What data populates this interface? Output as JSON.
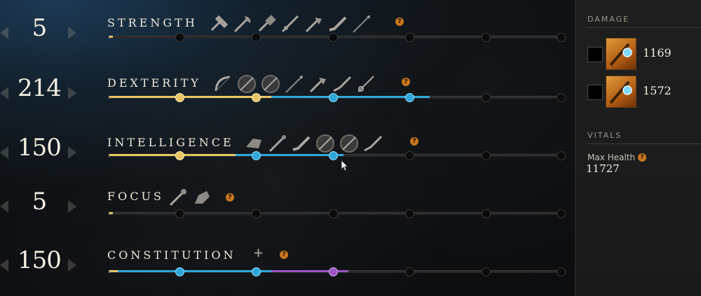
{
  "attributes": [
    {
      "name": "STRENGTH",
      "value": "5",
      "gold_end": 0.01,
      "blue_end": 0,
      "purple_end": 0,
      "markers": [],
      "weapons": [
        "war-hammer-icon",
        "great-axe-icon",
        "sledge-hammer-icon",
        "sword-icon",
        "hatchet-icon",
        "blunderbuss-icon",
        "spear-icon"
      ]
    },
    {
      "name": "DEXTERITY",
      "value": "214",
      "gold_end": 0.36,
      "blue_end": 0.71,
      "purple_end": 0,
      "markers": [
        "gold",
        "gold",
        "blue",
        "blue"
      ],
      "weapons": [
        "bow-icon",
        "round-shield-icon",
        "round-shield-icon",
        "spear-icon",
        "hatchet-icon",
        "musket-icon",
        "rapier-icon"
      ]
    },
    {
      "name": "INTELLIGENCE",
      "value": "150",
      "gold_end": 0.28,
      "blue_end": 0.52,
      "purple_end": 0,
      "markers": [
        "gold",
        "blue",
        "blue"
      ],
      "weapons": [
        "void-gauntlet-icon",
        "fire-staff-icon",
        "blunderbuss-icon",
        "round-shield-icon",
        "round-shield-icon",
        "musket-icon"
      ]
    },
    {
      "name": "FOCUS",
      "value": "5",
      "gold_end": 0.01,
      "blue_end": 0,
      "purple_end": 0,
      "markers": [],
      "weapons": [
        "life-staff-icon",
        "ice-gauntlet-icon"
      ]
    },
    {
      "name": "CONSTITUTION",
      "value": "150",
      "gold_end": 0.02,
      "blue_end": 0.36,
      "purple_end": 0.53,
      "markers": [
        "blue",
        "blue",
        "purple"
      ],
      "weapons": []
    }
  ],
  "help_symbol": "?",
  "constitution_plus": "+",
  "side": {
    "damage_heading": "DAMAGE",
    "damage_rows": [
      {
        "value": "1169",
        "weapon_icon": "fire-staff-weapon-icon"
      },
      {
        "value": "1572",
        "weapon_icon": "fire-staff-weapon-icon"
      }
    ],
    "vitals_heading": "VITALS",
    "max_health_label": "Max Health",
    "max_health_value": "11727"
  },
  "colors": {
    "gold": "#e8c567",
    "blue": "#2fa7d9",
    "purple": "#9a55c2",
    "help": "#c9761d"
  }
}
